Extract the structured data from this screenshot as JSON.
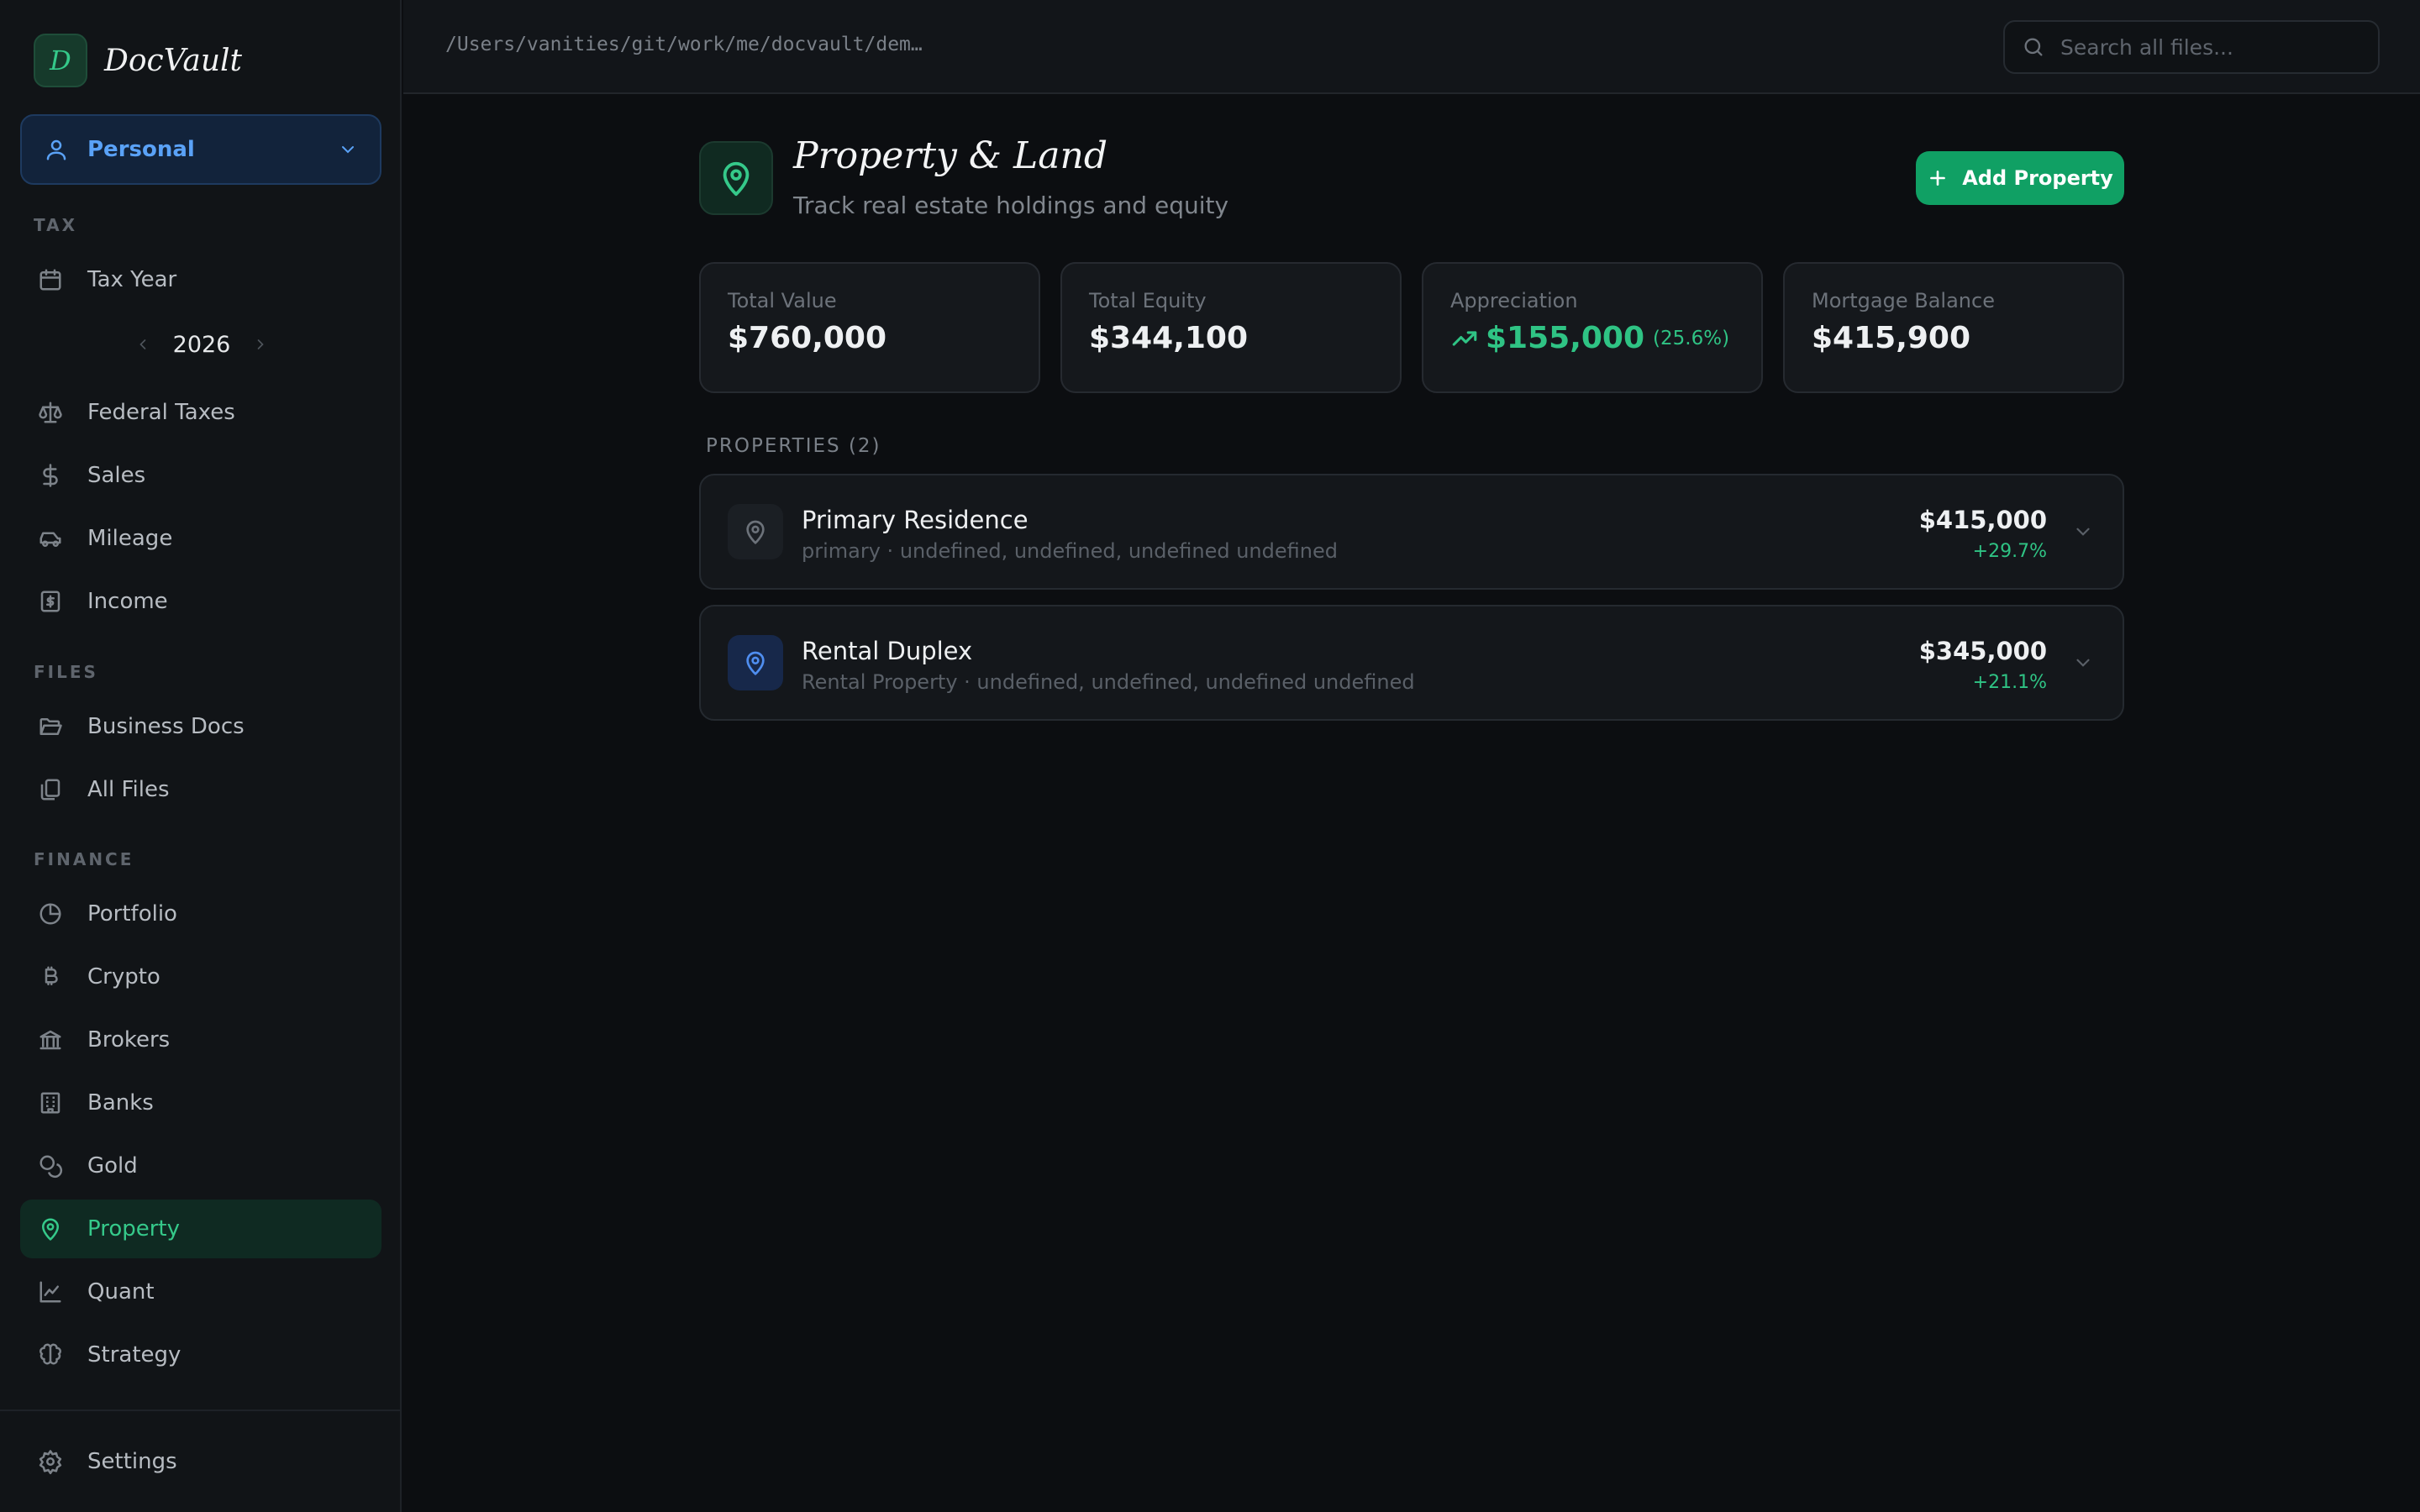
{
  "app": {
    "logo_letter": "D",
    "name": "DocVault"
  },
  "profile": {
    "label": "Personal"
  },
  "sidebar": {
    "tax_label": "TAX",
    "tax_year_label": "Tax Year",
    "year": "2026",
    "tax_items": [
      {
        "label": "Federal Taxes",
        "icon": "scale-icon"
      },
      {
        "label": "Sales",
        "icon": "dollar-icon"
      },
      {
        "label": "Mileage",
        "icon": "car-icon"
      },
      {
        "label": "Income",
        "icon": "receipt-icon"
      }
    ],
    "files_label": "FILES",
    "files_items": [
      {
        "label": "Business Docs",
        "icon": "folder-open-icon"
      },
      {
        "label": "All Files",
        "icon": "files-icon"
      }
    ],
    "finance_label": "FINANCE",
    "finance_items": [
      {
        "label": "Portfolio",
        "icon": "pie-chart-icon"
      },
      {
        "label": "Crypto",
        "icon": "bitcoin-icon"
      },
      {
        "label": "Brokers",
        "icon": "bank-icon"
      },
      {
        "label": "Banks",
        "icon": "building-icon"
      },
      {
        "label": "Gold",
        "icon": "coins-icon"
      },
      {
        "label": "Property",
        "icon": "map-pin-icon"
      },
      {
        "label": "Quant",
        "icon": "line-chart-icon"
      },
      {
        "label": "Strategy",
        "icon": "brain-icon"
      }
    ],
    "settings_label": "Settings"
  },
  "topbar": {
    "path": "/Users/vanities/git/work/me/docvault/dem…",
    "search_placeholder": "Search all files..."
  },
  "page": {
    "title": "Property & Land",
    "subtitle": "Track real estate holdings and equity",
    "add_button": "Add Property"
  },
  "stats": [
    {
      "label": "Total Value",
      "value": "$760,000"
    },
    {
      "label": "Total Equity",
      "value": "$344,100"
    },
    {
      "label": "Appreciation",
      "value": "$155,000",
      "pct": "(25.6%)"
    },
    {
      "label": "Mortgage Balance",
      "value": "$415,900"
    }
  ],
  "properties_label": "PROPERTIES (2)",
  "properties": [
    {
      "name": "Primary Residence",
      "meta": "primary · undefined, undefined, undefined undefined",
      "value": "$415,000",
      "change": "+29.7%"
    },
    {
      "name": "Rental Duplex",
      "meta": "Rental Property · undefined, undefined, undefined undefined",
      "value": "$345,000",
      "change": "+21.1%"
    }
  ],
  "colors": {
    "accent_green": "#2fc384",
    "button_green": "#10a064",
    "accent_blue": "#5aa2f7",
    "background": "#0c0e11"
  }
}
